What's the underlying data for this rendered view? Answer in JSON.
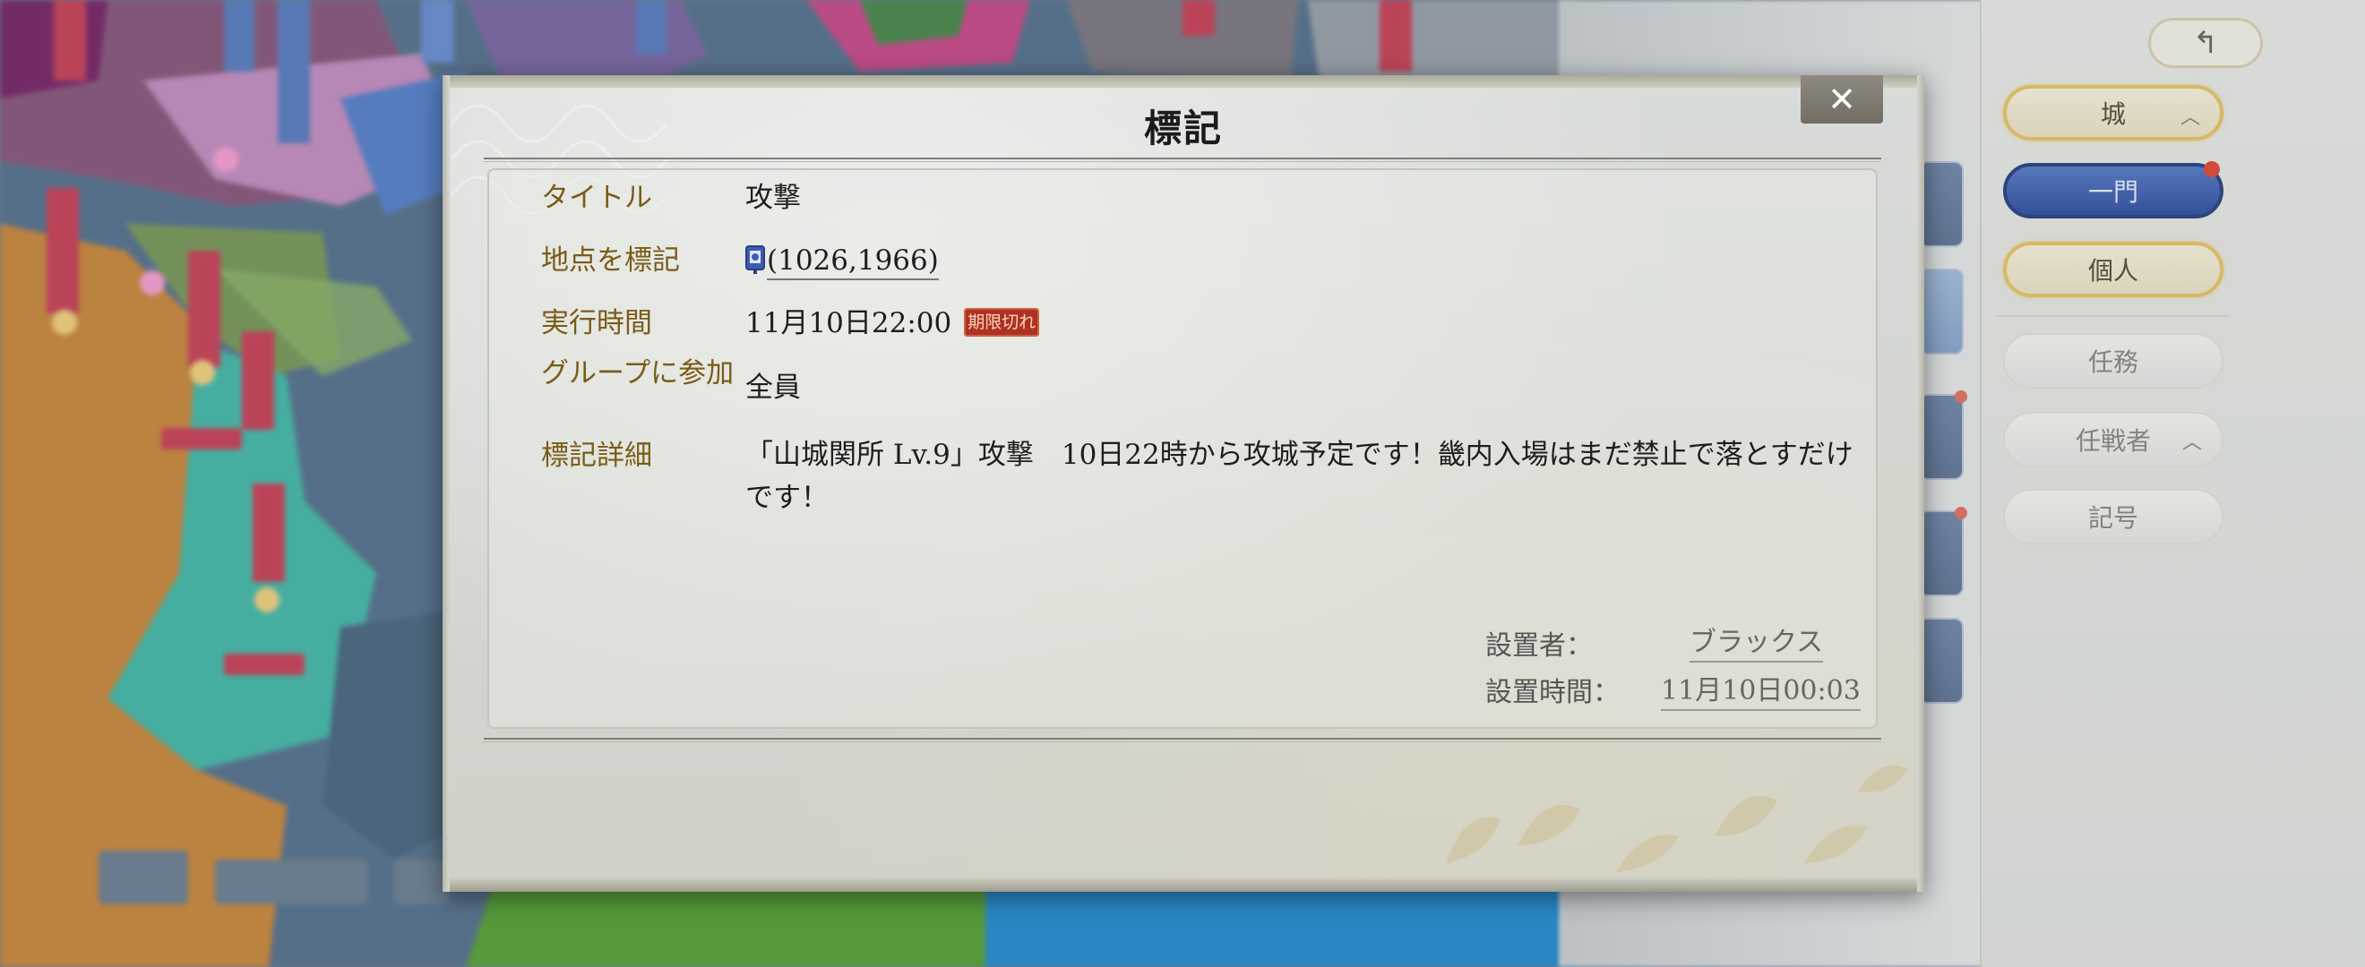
{
  "dialog": {
    "title": "標記",
    "close_icon": "close-icon",
    "fields": {
      "title_label": "タイトル",
      "title_value": "攻撃",
      "location_label": "地点を標記",
      "location_icon": "castle-marker-icon",
      "location_value": "(1026,1966)",
      "time_label": "実行時間",
      "time_value": "11月10日22:00",
      "expired_badge": "期限切れ",
      "group_label": "グループに参加",
      "group_value": "全員",
      "detail_label": "標記詳細",
      "detail_value": "「山城関所 Lv.9」攻撃　10日22時から攻城予定です！畿内入場はまだ禁止で落とすだけです！"
    },
    "meta": {
      "setter_label": "設置者：",
      "setter_value": "ブラックス",
      "set_time_label": "設置時間：",
      "set_time_value": "11月10日00:03"
    }
  },
  "side_panel": {
    "back_icon": "back-arrow-icon",
    "buttons": [
      {
        "label": "城",
        "style": "gold",
        "has_chevron": true
      },
      {
        "label": "一門",
        "style": "blue",
        "badge": true
      },
      {
        "label": "個人",
        "style": "gold"
      },
      {
        "label": "任務",
        "style": "plain"
      },
      {
        "label": "任戦者",
        "style": "plain",
        "has_chevron": true
      },
      {
        "label": "記号",
        "style": "plain"
      }
    ]
  },
  "colors": {
    "label_gold": "#7a5c16",
    "expired_red": "#b03025",
    "dialog_bg": "#d5d8d4"
  }
}
